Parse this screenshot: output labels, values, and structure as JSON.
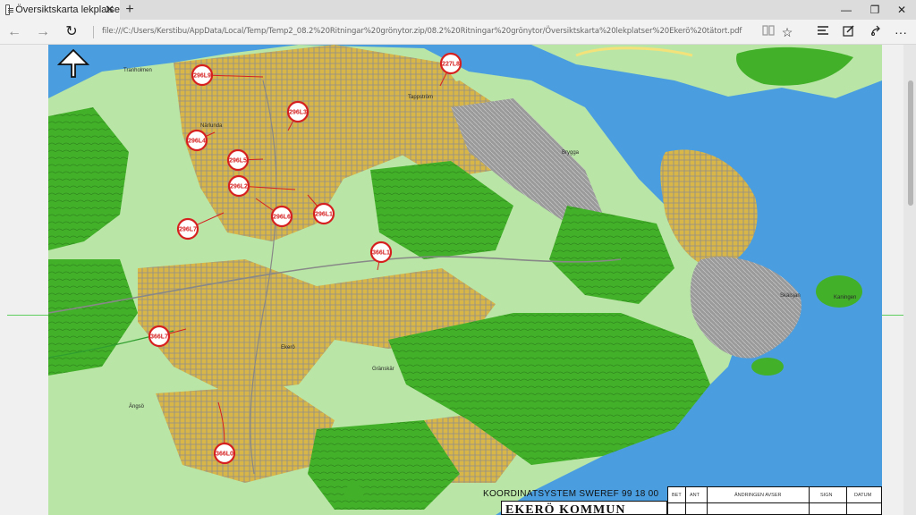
{
  "browser": {
    "tab_title": "Översiktskarta lekplatse",
    "tab_close": "✕",
    "new_tab": "+",
    "address": "file:///C:/Users/Kerstibu/AppData/Local/Temp/Temp2_08.2%20Ritningar%20grönytor.zip/08.2%20Ritningar%20grönytor/Översiktskarta%20lekplatser%20Ekerö%20tätort.pdf",
    "window_buttons": {
      "minimize": "—",
      "maximize": "❐",
      "close": "✕"
    },
    "icons": [
      "back-icon",
      "forward-icon",
      "refresh-icon",
      "reading-view-icon",
      "favorite-star-icon",
      "hub-icon",
      "web-note-icon",
      "share-icon",
      "more-icon"
    ]
  },
  "map": {
    "markers": [
      {
        "id": "296L9"
      },
      {
        "id": "227L8"
      },
      {
        "id": "296L3"
      },
      {
        "id": "296L4"
      },
      {
        "id": "296L5"
      },
      {
        "id": "296L2"
      },
      {
        "id": "296L6"
      },
      {
        "id": "296L1"
      },
      {
        "id": "296L7"
      },
      {
        "id": "366L1"
      },
      {
        "id": "366L7"
      },
      {
        "id": "366L0"
      }
    ],
    "places": [
      "Tranholmen",
      "Närlunda",
      "Tappström",
      "Brygga",
      "Gränskär",
      "Ängsö",
      "Skälsjan",
      "Kaningen",
      "Ekerö"
    ],
    "coordinate_system": "KOORDINATSYSTEM SWEREF 99 18 00",
    "municipality": "EKERÖ KOMMUN",
    "revision_table": {
      "col1": "BET",
      "col2": "ANT",
      "col3": "ÄNDRINGEN AVSER",
      "col4": "SIGN",
      "col5": "DATUM"
    },
    "colors": {
      "water": "#4a9ee0",
      "forest": "#43b02a",
      "light_green": "#b9e6a6",
      "urban": "#d9b648",
      "marker_red": "#d62020"
    }
  }
}
